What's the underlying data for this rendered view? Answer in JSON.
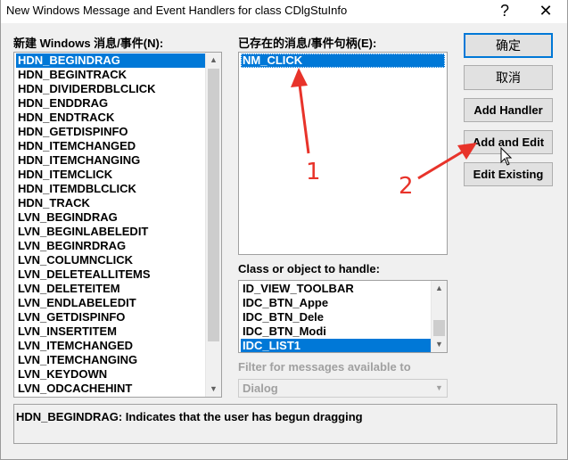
{
  "window": {
    "title": "New Windows Message and Event Handlers for class CDlgStuInfo",
    "help_glyph": "?",
    "close_glyph": "✕"
  },
  "new_messages": {
    "label": "新建 Windows 消息/事件(N):",
    "items": [
      "HDN_BEGINDRAG",
      "HDN_BEGINTRACK",
      "HDN_DIVIDERDBLCLICK",
      "HDN_ENDDRAG",
      "HDN_ENDTRACK",
      "HDN_GETDISPINFO",
      "HDN_ITEMCHANGED",
      "HDN_ITEMCHANGING",
      "HDN_ITEMCLICK",
      "HDN_ITEMDBLCLICK",
      "HDN_TRACK",
      "LVN_BEGINDRAG",
      "LVN_BEGINLABELEDIT",
      "LVN_BEGINRDRAG",
      "LVN_COLUMNCLICK",
      "LVN_DELETEALLITEMS",
      "LVN_DELETEITEM",
      "LVN_ENDLABELEDIT",
      "LVN_GETDISPINFO",
      "LVN_INSERTITEM",
      "LVN_ITEMCHANGED",
      "LVN_ITEMCHANGING",
      "LVN_KEYDOWN",
      "LVN_ODCACHEHINT"
    ],
    "selected": "HDN_BEGINDRAG"
  },
  "existing_handlers": {
    "label": "已存在的消息/事件句柄(E):",
    "items": [
      "NM_CLICK"
    ],
    "selected": "NM_CLICK"
  },
  "class_objects": {
    "label": "Class or object to handle:",
    "items": [
      "ID_VIEW_TOOLBAR",
      "IDC_BTN_Appe",
      "IDC_BTN_Dele",
      "IDC_BTN_Modi",
      "IDC_LIST1"
    ],
    "selected": "IDC_LIST1"
  },
  "filter": {
    "label": "Filter for messages available to",
    "value": "Dialog"
  },
  "buttons": {
    "ok": "确定",
    "cancel": "取消",
    "add_handler": "Add Handler",
    "add_and_edit": "Add and Edit",
    "edit_existing": "Edit Existing"
  },
  "status": {
    "text": "HDN_BEGINDRAG:  Indicates that the user has begun dragging"
  },
  "annotations": {
    "marker_1": "1",
    "marker_2": "2",
    "color": "#e8332a"
  },
  "icons": {
    "scroll_up": "▲",
    "scroll_down": "▼"
  }
}
